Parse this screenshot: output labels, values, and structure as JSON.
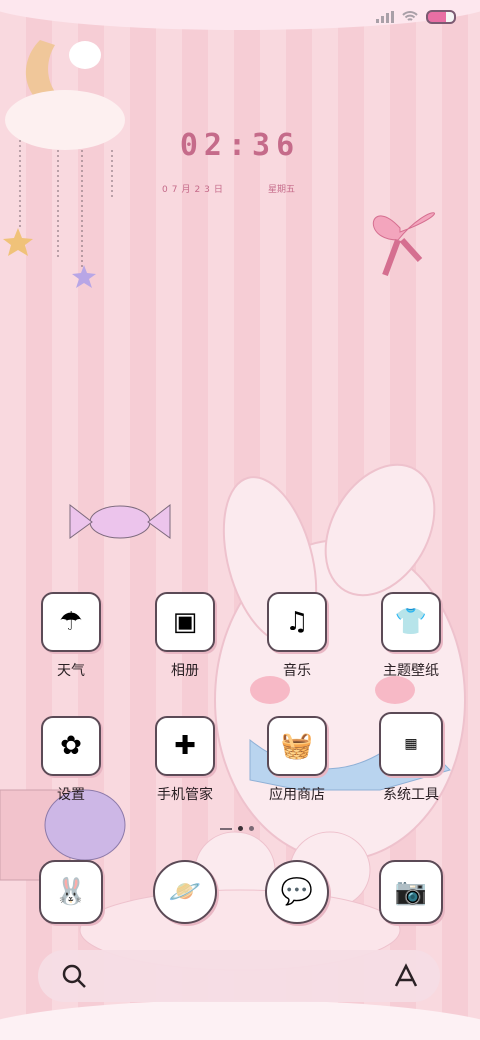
{
  "status": {
    "wifi": "wifi",
    "battery_level_percent": 70
  },
  "clock": {
    "time": "02:36",
    "date": "07月23日",
    "weekday": "星期五"
  },
  "apps": {
    "row1": [
      {
        "label": "天气",
        "icon": "weather-icon"
      },
      {
        "label": "相册",
        "icon": "album-icon"
      },
      {
        "label": "音乐",
        "icon": "music-icon"
      },
      {
        "label": "主题壁纸",
        "icon": "theme-icon"
      }
    ],
    "row2": [
      {
        "label": "设置",
        "icon": "settings-icon"
      },
      {
        "label": "手机管家",
        "icon": "phone-manager-icon"
      },
      {
        "label": "应用商店",
        "icon": "app-store-icon"
      },
      {
        "label": "系统工具",
        "icon": "system-tools-icon"
      }
    ]
  },
  "dock": [
    {
      "icon": "phone-icon"
    },
    {
      "icon": "browser-icon"
    },
    {
      "icon": "messages-icon"
    },
    {
      "icon": "camera-icon"
    }
  ],
  "colors": {
    "accent": "#c56b8a",
    "stripe_light": "#f9d9df",
    "stripe_dark": "#f6cdd5"
  }
}
